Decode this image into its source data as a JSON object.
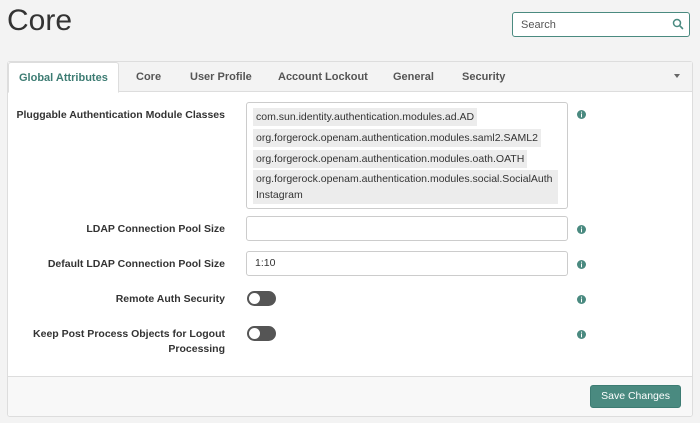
{
  "page": {
    "title": "Core"
  },
  "search": {
    "placeholder": "Search",
    "value": ""
  },
  "tabs": [
    {
      "label": "Global Attributes",
      "active": true
    },
    {
      "label": "Core"
    },
    {
      "label": "User Profile"
    },
    {
      "label": "Account Lockout"
    },
    {
      "label": "General"
    },
    {
      "label": "Security"
    }
  ],
  "form": {
    "pam": {
      "label": "Pluggable Authentication Module Classes",
      "items": [
        "com.sun.identity.authentication.modules.ad.AD",
        "org.forgerock.openam.authentication.modules.saml2.SAML2",
        "org.forgerock.openam.authentication.modules.oath.OATH",
        "org.forgerock.openam.authentication.modules.social.SocialAuthInstagram"
      ]
    },
    "ldap_pool_size": {
      "label": "LDAP Connection Pool Size",
      "value": ""
    },
    "default_ldap_pool_size": {
      "label": "Default LDAP Connection Pool Size",
      "value": "1:10"
    },
    "remote_auth_security": {
      "label": "Remote Auth Security",
      "enabled": false
    },
    "keep_post_process": {
      "label": "Keep Post Process Objects for Logout Processing",
      "enabled": false
    }
  },
  "footer": {
    "save_label": "Save Changes"
  },
  "colors": {
    "accent": "#4a8a80",
    "toggle_off": "#555555"
  }
}
